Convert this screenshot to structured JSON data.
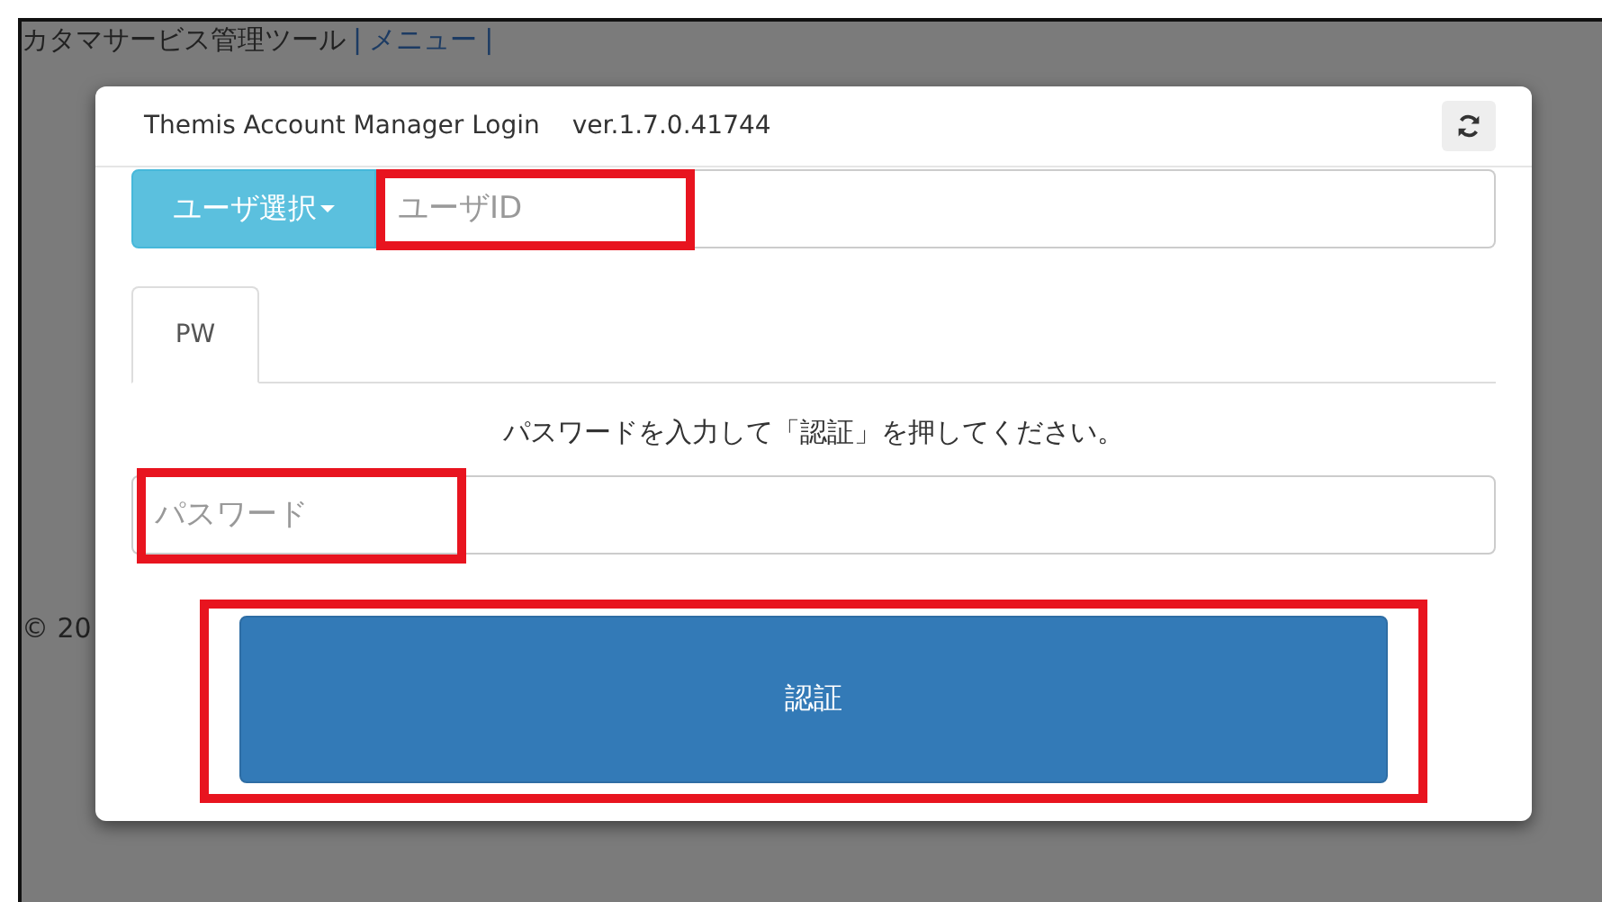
{
  "background_page": {
    "header": [
      {
        "kind": "title",
        "text": "カタマサービス管理ツール"
      },
      {
        "kind": "separator",
        "text": "|"
      },
      {
        "kind": "link",
        "text": "メニュー"
      },
      {
        "kind": "separator",
        "text": "|"
      }
    ],
    "footer": "© 20"
  },
  "modal": {
    "title": "Themis Account Manager Login",
    "version": "ver.1.7.0.41744",
    "user_select_button": "ユーザ選択",
    "user_id": {
      "placeholder": "ユーザID",
      "highlighted": true
    },
    "tabs": [
      {
        "label": "PW",
        "selected": true
      }
    ],
    "instruction": "パスワードを入力して「認証」を押してください。",
    "password": {
      "placeholder": "パスワード",
      "highlighted": true
    },
    "submit": {
      "label": "認証",
      "highlighted": true
    }
  }
}
